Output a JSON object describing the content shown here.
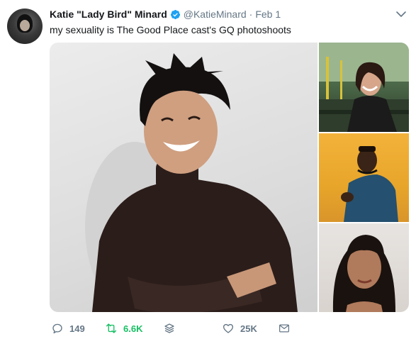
{
  "tweet": {
    "author_name": "Katie \"Lady Bird\" Minard",
    "handle": "@KatieMinard",
    "separator": "·",
    "date": "Feb 1",
    "verified": true,
    "text": "my sexuality is The Good Place cast's GQ photoshoots"
  },
  "media": {
    "images": [
      {
        "description_icon": "photo"
      },
      {
        "description_icon": "photo"
      },
      {
        "description_icon": "photo"
      },
      {
        "description_icon": "photo"
      }
    ]
  },
  "actions": {
    "reply_count": "149",
    "retweet_count": "6.6K",
    "like_count": "25K"
  },
  "colors": {
    "text": "#14171a",
    "secondary": "#657786",
    "verified": "#1da1f2",
    "retweet_active": "#17bf63"
  },
  "icons": {
    "verified": "verified-badge-icon",
    "caret": "chevron-down-icon",
    "reply": "reply-icon",
    "retweet": "retweet-icon",
    "stack": "layers-icon",
    "like": "heart-icon",
    "dm": "envelope-icon"
  }
}
